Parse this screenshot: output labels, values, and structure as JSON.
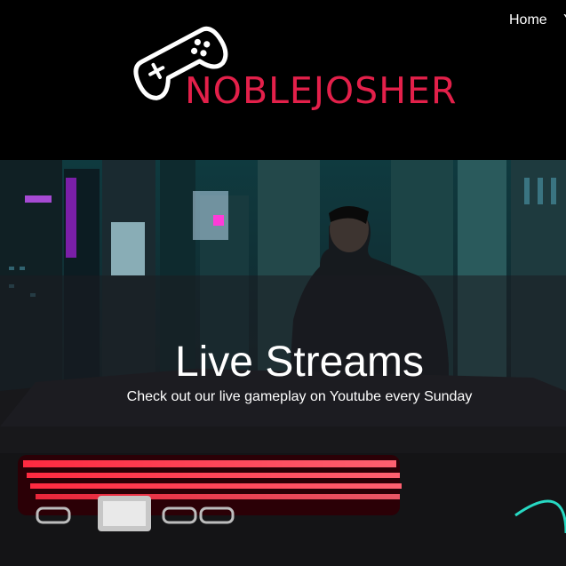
{
  "brand": {
    "name": "NOBLEJOSHER",
    "accent_color": "#e3204a",
    "icon": "gamepad-icon"
  },
  "nav": {
    "items": [
      {
        "label": "Home"
      },
      {
        "label": "Y"
      }
    ]
  },
  "hero": {
    "title": "Live Streams",
    "subtitle": "Check out our live gameplay on Youtube every Sunday",
    "background": "cyberpunk-city-night-scene"
  }
}
